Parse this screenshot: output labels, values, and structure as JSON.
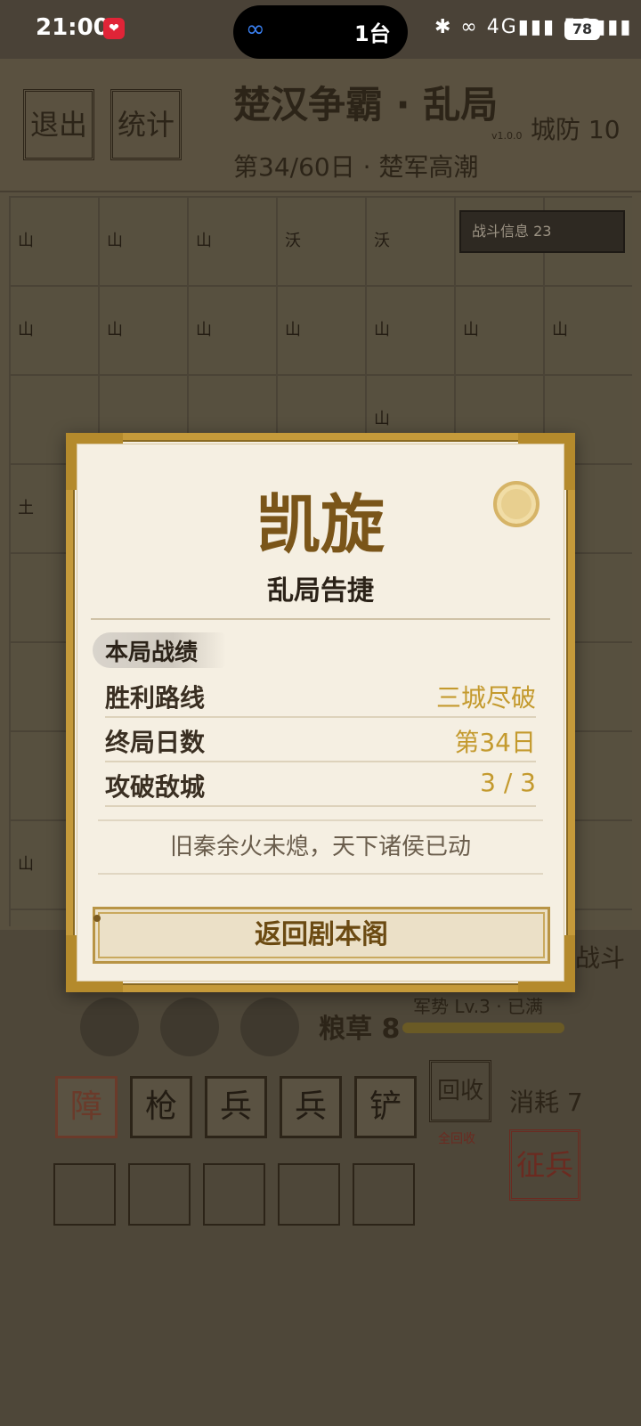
{
  "status_bar": {
    "time": "21:00",
    "notification_icon": "heart-badge-icon",
    "pill_text": "1台",
    "network_icons": "✱ ∞ 4G▮▮▮ 5G▮▮▮",
    "battery": "78"
  },
  "header": {
    "exit_label": "退出",
    "stats_label": "统计",
    "title": "楚汉争霸 · 乱局",
    "version": "v1.0.0",
    "defense": "城防 10",
    "day_status": "第34/60日 · 楚军高潮"
  },
  "board": {
    "battle_info": "战斗信息 23",
    "tile_labels": [
      "山",
      "山",
      "山",
      "沃",
      "沃",
      "山",
      "山",
      "山",
      "山",
      "山",
      "山",
      "山",
      "山",
      "土",
      "山"
    ]
  },
  "bottom": {
    "battle_label": "战斗",
    "grain": "粮草 8",
    "momentum": "军势 Lv.3 · 已满",
    "momentum_fill": 1.0,
    "cards": [
      {
        "label": "障",
        "red": true
      },
      {
        "label": "枪",
        "red": false
      },
      {
        "label": "兵",
        "red": false
      },
      {
        "label": "兵",
        "red": false
      },
      {
        "label": "铲",
        "red": false
      }
    ],
    "recall_label": "回收",
    "recall_all_label": "全回收",
    "consume": "消耗 7",
    "conscript_label": "征兵"
  },
  "modal": {
    "title": "凯旋",
    "subtitle": "乱局告捷",
    "section_title": "本局战绩",
    "rows": [
      {
        "label": "胜利路线",
        "value": "三城尽破"
      },
      {
        "label": "终局日数",
        "value": "第34日"
      },
      {
        "label": "攻破敌城",
        "value": "3 / 3"
      }
    ],
    "quote": "旧秦余火未熄，天下诸侯已动",
    "return_label": "返回剧本阁"
  },
  "colors": {
    "gold": "#c59a3a",
    "title_brown": "#7a5519",
    "value_gold": "#c49a2e",
    "paper": "#f5efe2"
  }
}
